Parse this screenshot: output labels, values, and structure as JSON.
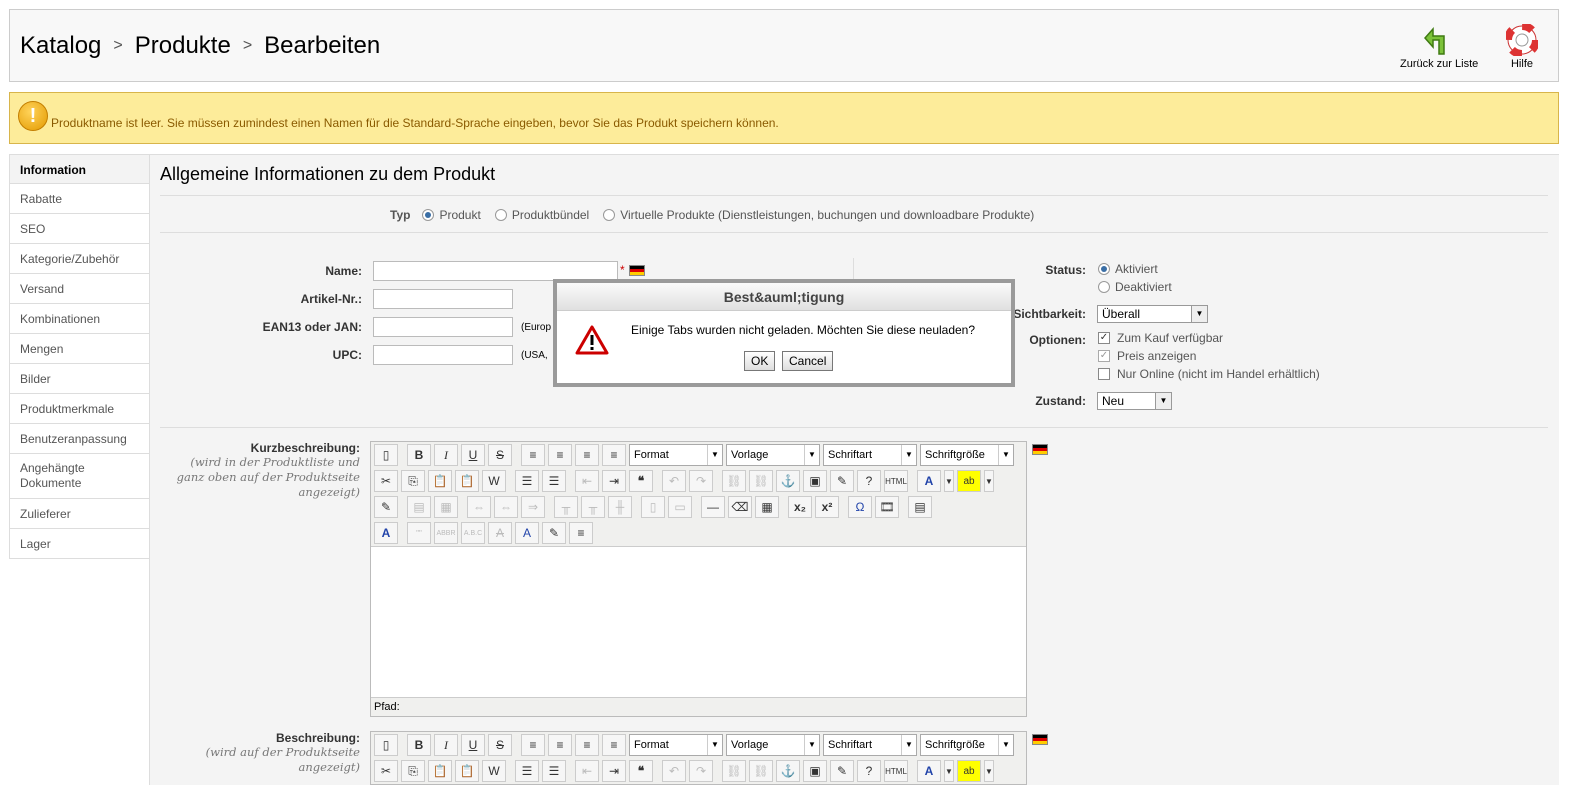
{
  "header": {
    "breadcrumb": [
      "Katalog",
      "Produkte",
      "Bearbeiten"
    ],
    "back_label": "Zurück zur Liste",
    "help_label": "Hilfe"
  },
  "warning": {
    "text": "Produktname ist leer. Sie müssen zumindest einen Namen für die Standard-Sprache eingeben, bevor Sie das Produkt speichern können."
  },
  "sidebar": {
    "items": [
      "Information",
      "Rabatte",
      "SEO",
      "Kategorie/Zubehör",
      "Versand",
      "Kombinationen",
      "Mengen",
      "Bilder",
      "Produktmerkmale",
      "Benutzeranpassung",
      "Angehängte Dokumente",
      "Zulieferer",
      "Lager"
    ]
  },
  "main": {
    "title": "Allgemeine Informationen zu dem Produkt",
    "type": {
      "label": "Typ",
      "options": [
        "Produkt",
        "Produktbündel",
        "Virtuelle Produkte (Dienstleistungen, buchungen und downloadbare Produkte)"
      ],
      "selected": "Produkt"
    },
    "fields": {
      "name_label": "Name:",
      "name_required": "*",
      "sku_label": "Artikel-Nr.:",
      "ean_label": "EAN13 oder JAN:",
      "ean_hint": "(Europ",
      "upc_label": "UPC:",
      "upc_hint": "(USA,"
    },
    "status": {
      "label": "Status:",
      "options": [
        "Aktiviert",
        "Deaktiviert"
      ],
      "selected": "Aktiviert"
    },
    "visibility": {
      "label": "Sichtbarkeit:",
      "value": "Überall"
    },
    "options": {
      "label": "Optionen:",
      "items": [
        {
          "text": "Zum Kauf verfügbar",
          "checked": true
        },
        {
          "text": "Preis anzeigen",
          "checked": true
        },
        {
          "text": "Nur Online (nicht im Handel erhältlich)",
          "checked": false
        }
      ]
    },
    "condition": {
      "label": "Zustand:",
      "value": "Neu"
    },
    "short_desc": {
      "label": "Kurzbeschreibung:",
      "sub": "(wird in der Produktliste und ganz oben auf der Produktseite angezeigt)"
    },
    "desc": {
      "label": "Beschreibung:",
      "sub": "(wird auf der Produktseite angezeigt)"
    },
    "editor": {
      "format": "Format",
      "template": "Vorlage",
      "font": "Schriftart",
      "size": "Schriftgröße",
      "path": "Pfad:"
    }
  },
  "dialog": {
    "title": "Best&auml;tigung",
    "message": "Einige Tabs wurden nicht geladen. Möchten Sie diese neuladen?",
    "ok": "OK",
    "cancel": "Cancel"
  }
}
